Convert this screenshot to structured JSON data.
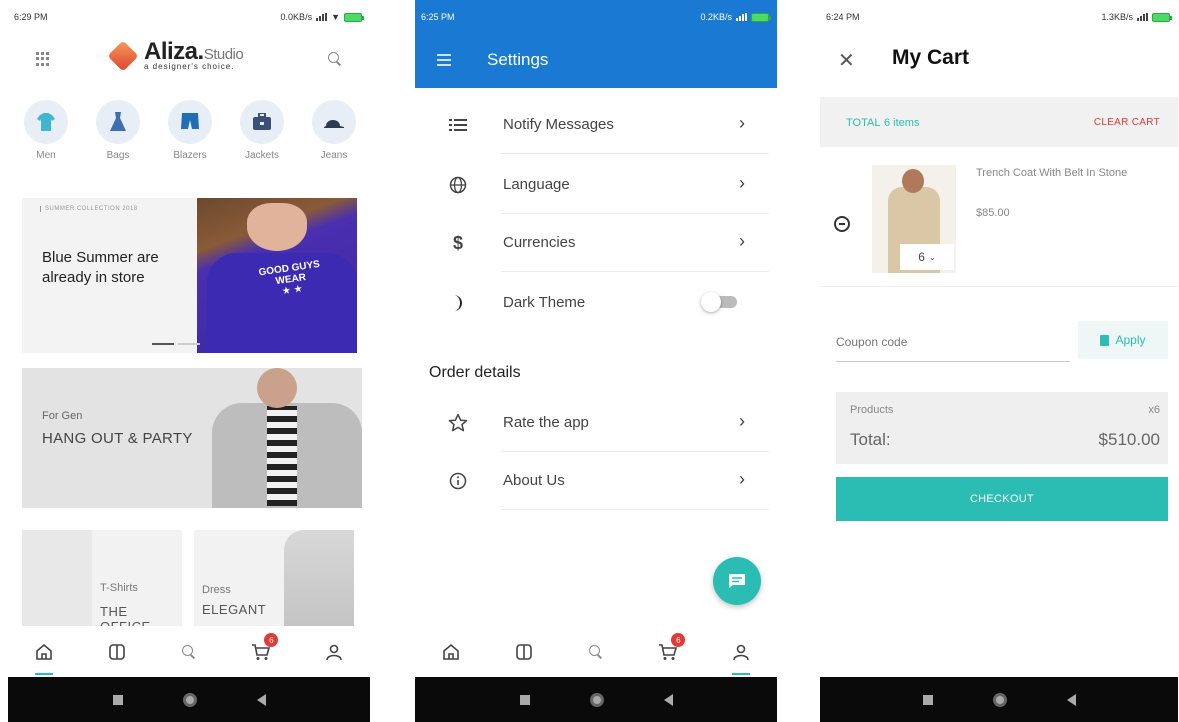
{
  "screen1": {
    "status_time": "6:29 PM",
    "status_speed": "0.0KB/s",
    "logo_name": "Aliza.",
    "logo_suffix": "Studio",
    "logo_tagline": "a designer's choice.",
    "categories": [
      {
        "label": "Men",
        "icon": "tshirt-icon",
        "color": "#3fb6d0"
      },
      {
        "label": "Bags",
        "icon": "dress-icon",
        "color": "#3d6fb0"
      },
      {
        "label": "Blazers",
        "icon": "shorts-icon",
        "color": "#1f6fb6"
      },
      {
        "label": "Jackets",
        "icon": "bag-icon",
        "color": "#3a4f7a"
      },
      {
        "label": "Jeans",
        "icon": "cap-icon",
        "color": "#2f3a4f"
      }
    ],
    "banner1": {
      "tag": "SUMMER COLLECTION 2018",
      "title": "Blue Summer are already in store"
    },
    "banner2": {
      "subtitle": "For Gen",
      "title": "HANG OUT & PARTY"
    },
    "tile1": {
      "subtitle": "T-Shirts",
      "title": "THE OFFICE"
    },
    "tile2": {
      "subtitle": "Dress",
      "title": "ELEGANT"
    },
    "cart_badge": "6"
  },
  "screen2": {
    "status_time": "6:25 PM",
    "status_speed": "0.2KB/s",
    "title": "Settings",
    "rows": [
      {
        "label": "Notify Messages",
        "icon": "list-icon"
      },
      {
        "label": "Language",
        "icon": "globe-icon"
      },
      {
        "label": "Currencies",
        "icon": "dollar-icon"
      },
      {
        "label": "Dark Theme",
        "icon": "moon-icon"
      }
    ],
    "section_title": "Order details",
    "order_rows": [
      {
        "label": "Rate the app",
        "icon": "star-icon"
      },
      {
        "label": "About Us",
        "icon": "info-icon"
      }
    ],
    "cart_badge": "6"
  },
  "screen3": {
    "status_time": "6:24 PM",
    "status_speed": "1.3KB/s",
    "title": "My Cart",
    "total_label": "TOTAL",
    "total_items": "6 items",
    "clear_label": "CLEAR CART",
    "product_name": "Trench Coat With Belt In Stone",
    "product_price": "$85.00",
    "quantity": "6",
    "coupon_placeholder": "Coupon code",
    "apply_label": "Apply",
    "products_label": "Products",
    "products_count": "x6",
    "total_text": "Total:",
    "total_value": "$510.00",
    "checkout_label": "CHECKOUT"
  },
  "colors": {
    "accent": "#2bbdb3",
    "appbar": "#1a79d2",
    "badge": "#e53935"
  }
}
